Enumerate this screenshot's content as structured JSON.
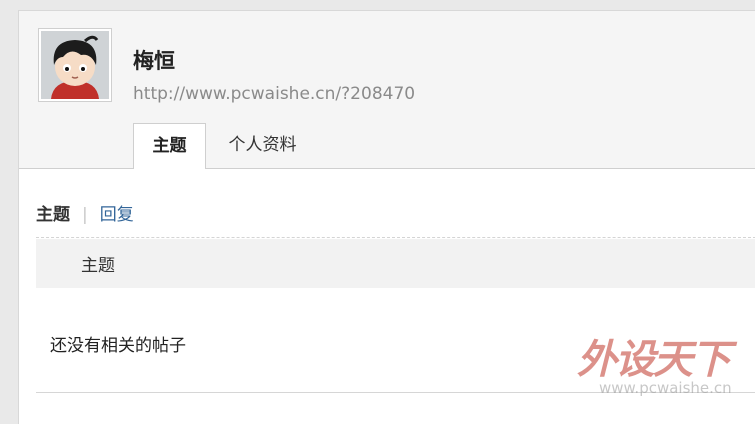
{
  "profile": {
    "name": "梅恒",
    "url": "http://www.pcwaishe.cn/?208470",
    "avatar": "cartoon-boy-avatar"
  },
  "tabs": [
    {
      "label": "主题",
      "active": true
    },
    {
      "label": "个人资料",
      "active": false
    }
  ],
  "sub_nav": {
    "active": "主题",
    "separator": "|",
    "link": "回复"
  },
  "table": {
    "header": "主题",
    "empty_message": "还没有相关的帖子"
  },
  "watermark": {
    "logo_text": "外设天下",
    "url": "www.pcwaishe.cn"
  },
  "colors": {
    "link": "#336699",
    "header_bg": "#f5f5f5",
    "table_head_bg": "#f2f2f2"
  }
}
